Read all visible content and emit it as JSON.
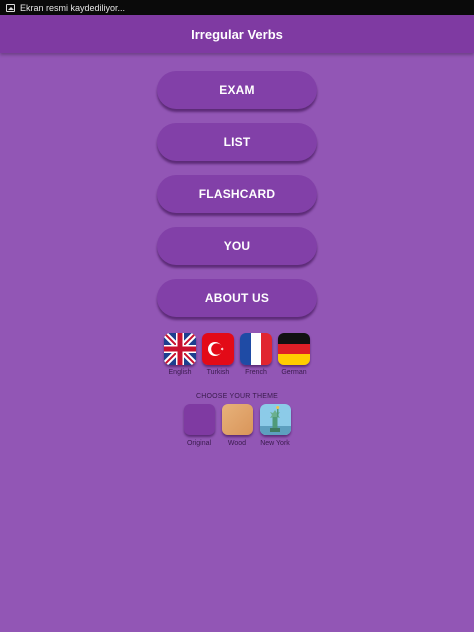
{
  "status_bar": {
    "notification_text": "Ekran resmi kaydediliyor..."
  },
  "app_bar": {
    "title": "Irregular Verbs"
  },
  "menu": [
    {
      "label": "EXAM"
    },
    {
      "label": "LIST"
    },
    {
      "label": "FLASHCARD"
    },
    {
      "label": "YOU"
    },
    {
      "label": "ABOUT US"
    }
  ],
  "languages": [
    {
      "label": "English",
      "icon": "uk-flag-icon"
    },
    {
      "label": "Turkish",
      "icon": "turkey-flag-icon"
    },
    {
      "label": "French",
      "icon": "france-flag-icon"
    },
    {
      "label": "German",
      "icon": "germany-flag-icon"
    }
  ],
  "themes": {
    "title": "CHOOSE YOUR THEME",
    "items": [
      {
        "label": "Original",
        "icon": "original-theme-swatch",
        "color": "#7f3aa2"
      },
      {
        "label": "Wood",
        "icon": "wood-theme-swatch",
        "color": "#e2a56b"
      },
      {
        "label": "New York",
        "icon": "statue-of-liberty-icon",
        "color": "#7ab7d8"
      }
    ]
  },
  "colors": {
    "background": "#9256b5",
    "app_bar": "#7f3aa2",
    "button": "#8240a8"
  }
}
